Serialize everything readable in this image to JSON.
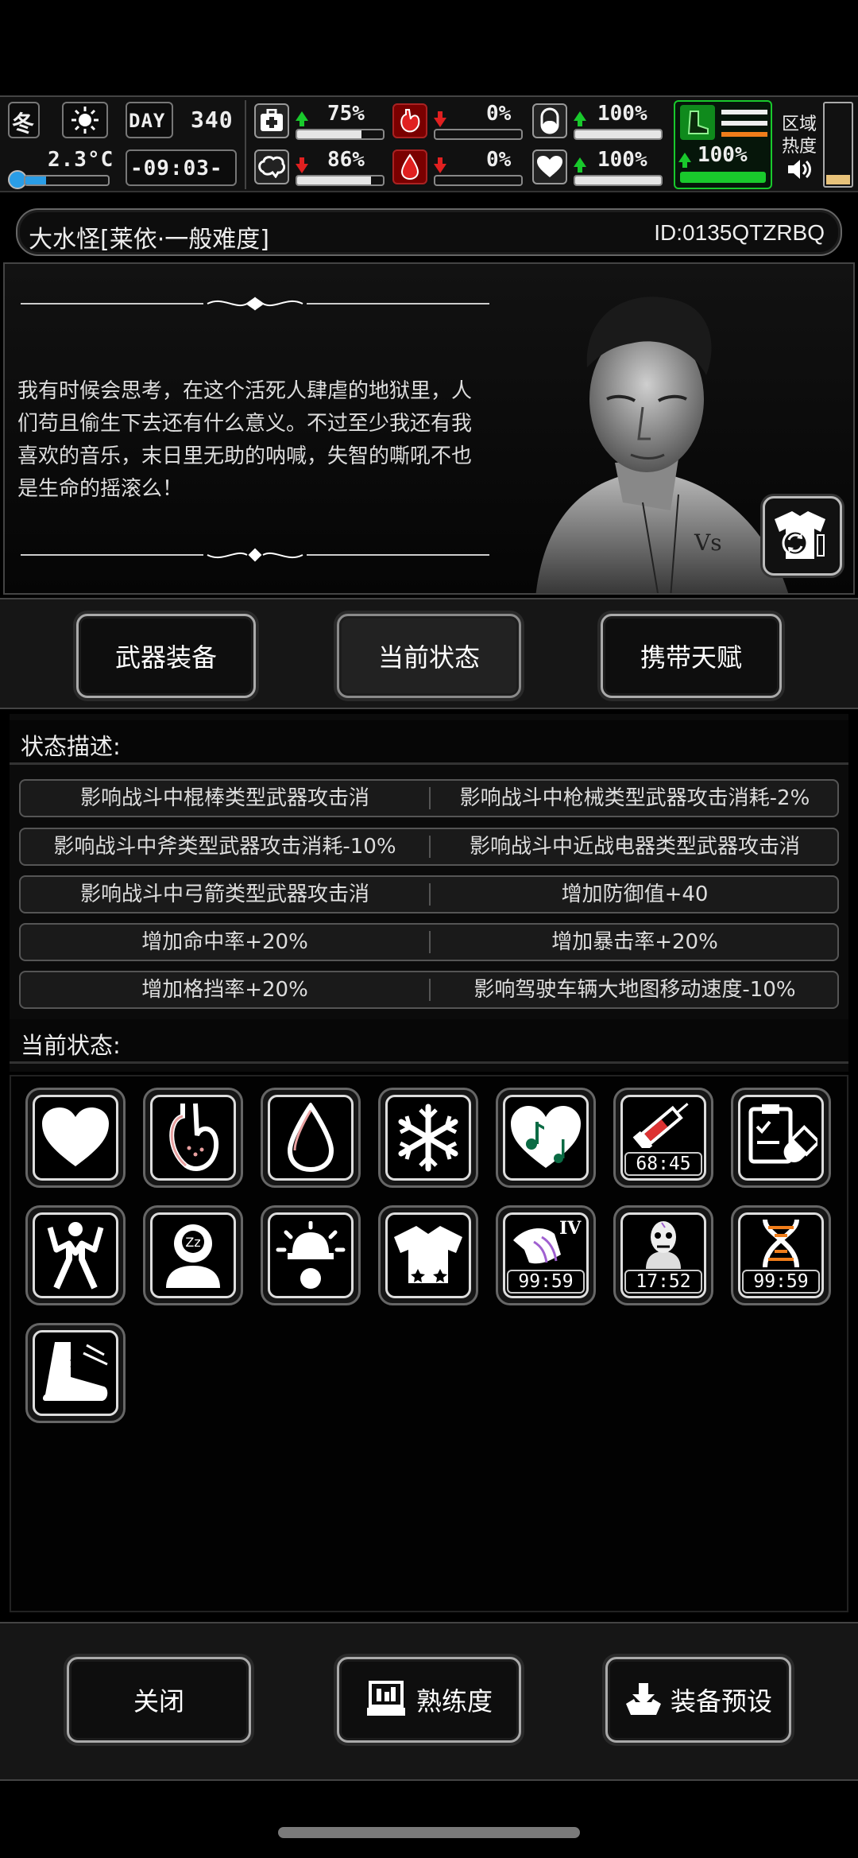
{
  "hud": {
    "season": "冬",
    "temperature": "2.3°C",
    "temperature_level": 0.25,
    "day_label": "DAY",
    "day": "340",
    "clock": "-09:03-",
    "stats": [
      {
        "name": "health-icon",
        "value": "75%",
        "level": 0.75,
        "trend": "up"
      },
      {
        "name": "stomach-icon",
        "value": "0%",
        "level": 0.0,
        "trend": "down"
      },
      {
        "name": "pill-icon",
        "value": "100%",
        "level": 1.0,
        "trend": "up"
      },
      {
        "name": "brain-icon",
        "value": "86%",
        "level": 0.86,
        "trend": "down"
      },
      {
        "name": "blood-drop-icon",
        "value": "0%",
        "level": 0.0,
        "trend": "down"
      },
      {
        "name": "heart-icon",
        "value": "100%",
        "level": 1.0,
        "trend": "up"
      }
    ],
    "stamina_value": "100%",
    "stamina_level": 1.0,
    "region_heat_label_1": "区域",
    "region_heat_label_2": "热度"
  },
  "header": {
    "character_name": "大水怪[莱依·一般难度]",
    "id": "ID:0135QTZRBQ"
  },
  "portrait": {
    "quote": "我有时候会思考，在这个活死人肆虐的地狱里，人们苟且偷生下去还有什么意义。不过至少我还有我喜欢的音乐，末日里无助的呐喊，失智的嘶吼不也是生命的摇滚么！"
  },
  "tabs": {
    "weapons": "武器装备",
    "status": "当前状态",
    "talents": "携带天赋"
  },
  "status_desc": {
    "title": "状态描述:",
    "rows": [
      [
        "影响战斗中棍棒类型武器攻击消",
        "影响战斗中枪械类型武器攻击消耗-2%"
      ],
      [
        "影响战斗中斧类型武器攻击消耗-10%",
        "影响战斗中近战电器类型武器攻击消"
      ],
      [
        "影响战斗中弓箭类型武器攻击消",
        "增加防御值+40"
      ],
      [
        "增加命中率+20%",
        "增加暴击率+20%"
      ],
      [
        "增加格挡率+20%",
        "影响驾驶车辆大地图移动速度-10%"
      ]
    ]
  },
  "current_status": {
    "title": "当前状态:",
    "icons": [
      {
        "name": "heart-status-icon",
        "timer": ""
      },
      {
        "name": "stomach-status-icon",
        "timer": ""
      },
      {
        "name": "water-drop-status-icon",
        "timer": ""
      },
      {
        "name": "snowflake-status-icon",
        "timer": ""
      },
      {
        "name": "music-heart-status-icon",
        "timer": ""
      },
      {
        "name": "syringe-status-icon",
        "timer": "68:45"
      },
      {
        "name": "medical-record-status-icon",
        "timer": ""
      },
      {
        "name": "strong-body-status-icon",
        "timer": ""
      },
      {
        "name": "mind-status-icon",
        "timer": ""
      },
      {
        "name": "alarm-status-icon",
        "timer": ""
      },
      {
        "name": "clothing-status-icon",
        "timer": ""
      },
      {
        "name": "arm-buff-status-icon",
        "timer": "99:59",
        "tier": "IV"
      },
      {
        "name": "zombie-face-status-icon",
        "timer": "17:52"
      },
      {
        "name": "dna-status-icon",
        "timer": "99:59"
      },
      {
        "name": "winged-boot-status-icon",
        "timer": ""
      }
    ]
  },
  "footer": {
    "close": "关闭",
    "proficiency": "熟练度",
    "preset": "装备预设"
  }
}
